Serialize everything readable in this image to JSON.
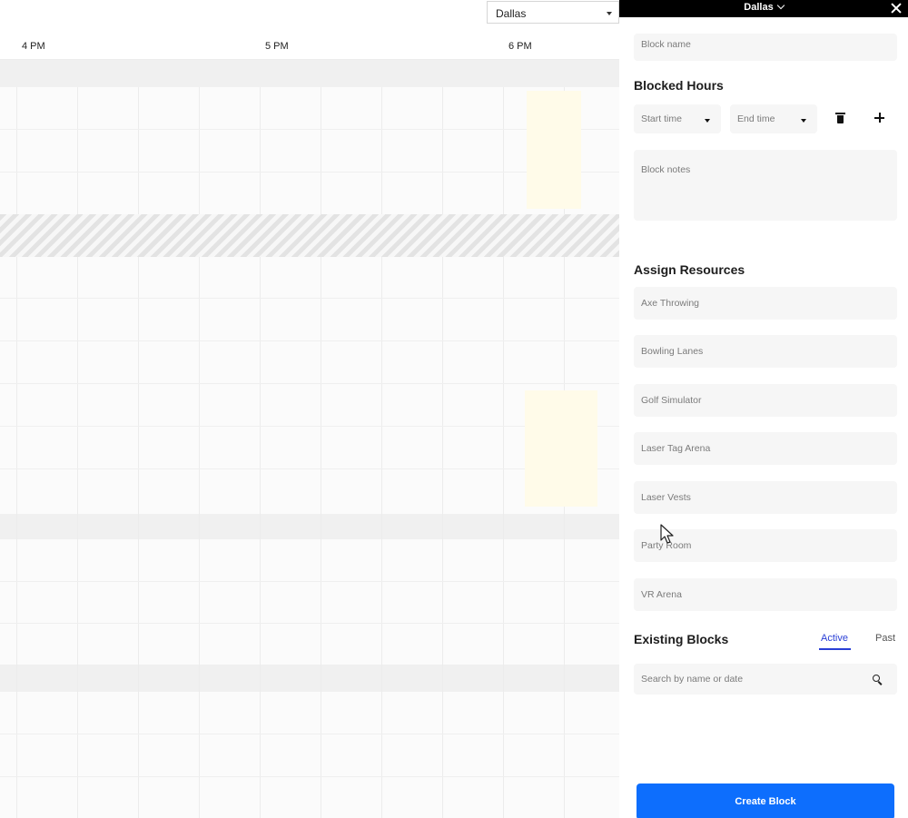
{
  "calendar": {
    "location_select": "Dallas",
    "time_columns": [
      "4 PM",
      "5 PM",
      "6 PM"
    ]
  },
  "panel": {
    "location": "Dallas",
    "block_name_placeholder": "Block name",
    "blocked_hours": {
      "title": "Blocked Hours",
      "start_time": "Start time",
      "end_time": "End time"
    },
    "block_notes_placeholder": "Block notes",
    "assign_resources": {
      "title": "Assign Resources",
      "items": [
        "Axe Throwing",
        "Bowling Lanes",
        "Golf Simulator",
        "Laser Tag Arena",
        "Laser Vests",
        "Party Room",
        "VR Arena"
      ]
    },
    "existing_blocks": {
      "title": "Existing Blocks",
      "tabs": [
        "Active",
        "Past"
      ],
      "active_tab": "Active",
      "search_placeholder": "Search by name or date"
    },
    "create_button": "Create Block"
  },
  "colors": {
    "primary_button": "#0d6efd",
    "active_tab": "#2a3fd6",
    "header_bg": "#000000"
  },
  "icons": [
    "chevron-down-icon",
    "close-icon",
    "trash-icon",
    "add-icon",
    "search-icon",
    "mouse-cursor-icon"
  ]
}
